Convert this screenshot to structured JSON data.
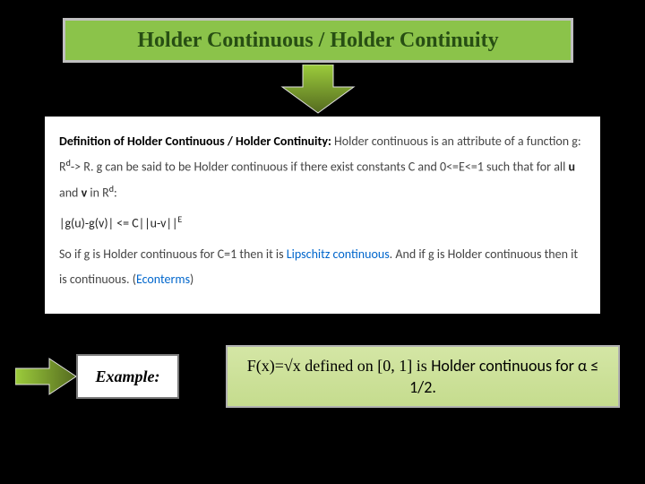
{
  "title": "Holder Continuous / Holder Continuity",
  "definition": {
    "heading": "Definition of Holder Continuous / Holder Continuity:",
    "line1": " Holder continuous is an attribute of a function g: R",
    "line1_sup": "d",
    "line1b": "-> R. g can be said to be Holder continuous if there exist constants C and 0<=E<=1 such that for all ",
    "u": "u",
    "and": " and ",
    "v": "v",
    "inR": " in R",
    "d2": "d",
    "colon": ":",
    "eq": "|g(u)-g(v)| <= C||u-v||",
    "eq_sup": "E",
    "line3a": "So if g is Holder continuous for C=1 then it is ",
    "link1": "Lipschitz continuous",
    "line3b": ". And if g is Holder continuous then it is continuous. (",
    "link2": "Econterms",
    "line3c": ")"
  },
  "example_label": "Example:",
  "formula": {
    "part1": "F(x)=√x  defined on [0, 1] is ",
    "part2": "Holder continuous for α ≤ 1/2."
  },
  "colors": {
    "green_box": "#8BC34A",
    "arrow_green": "#6a8f2f",
    "arrow_light": "#9ccc3c"
  }
}
